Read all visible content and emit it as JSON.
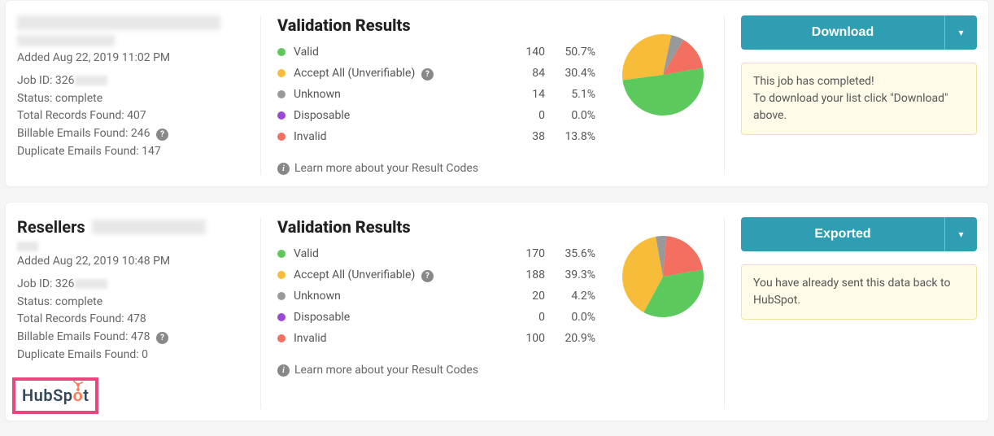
{
  "colors": {
    "valid": "#5cc95c",
    "accept": "#f7bd3a",
    "unknown": "#98999a",
    "disposable": "#9a4bd6",
    "invalid": "#f36f60",
    "btn": "#2f9eb3"
  },
  "common": {
    "vr_title": "Validation Results",
    "labels": {
      "valid": "Valid",
      "accept": "Accept All (Unverifiable)",
      "unknown": "Unknown",
      "disposable": "Disposable",
      "invalid": "Invalid"
    },
    "learn_more": "Learn more about your Result Codes",
    "added_prefix": "Added ",
    "jobid_prefix": "Job ID: 326",
    "status_prefix": "Status: ",
    "total_prefix": "Total Records Found: ",
    "billable_prefix": "Billable Emails Found: ",
    "dup_prefix": "Duplicate Emails Found: "
  },
  "jobs": [
    {
      "title": "",
      "added": "Aug 22, 2019 11:02 PM",
      "status": "complete",
      "total": "407",
      "billable": "246",
      "duplicate": "147",
      "billable_help": true,
      "button": "Download",
      "notice_line1": "This job has completed!",
      "notice_line2": "To download your list click \"Download\" above.",
      "hubspot": false,
      "stats": {
        "valid": {
          "count": "140",
          "pct": "50.7%"
        },
        "accept": {
          "count": "84",
          "pct": "30.4%"
        },
        "unknown": {
          "count": "14",
          "pct": "5.1%"
        },
        "disposable": {
          "count": "0",
          "pct": "0.0%"
        },
        "invalid": {
          "count": "38",
          "pct": "13.8%"
        }
      }
    },
    {
      "title": "Resellers",
      "added": "Aug 22, 2019 10:48 PM",
      "status": "complete",
      "total": "478",
      "billable": "478",
      "duplicate": "0",
      "billable_help": true,
      "button": "Exported",
      "notice_line1": "You have already sent this data back to HubSpot.",
      "notice_line2": "",
      "hubspot": true,
      "stats": {
        "valid": {
          "count": "170",
          "pct": "35.6%"
        },
        "accept": {
          "count": "188",
          "pct": "39.3%"
        },
        "unknown": {
          "count": "20",
          "pct": "4.2%"
        },
        "disposable": {
          "count": "0",
          "pct": "0.0%"
        },
        "invalid": {
          "count": "100",
          "pct": "20.9%"
        }
      }
    }
  ],
  "hubspot_brand": "HubSpot",
  "chart_data": [
    {
      "type": "pie",
      "title": "Validation Results",
      "categories": [
        "Valid",
        "Accept All (Unverifiable)",
        "Unknown",
        "Disposable",
        "Invalid"
      ],
      "values": [
        50.7,
        30.4,
        5.1,
        0.0,
        13.8
      ],
      "colors": [
        "#5cc95c",
        "#f7bd3a",
        "#98999a",
        "#9a4bd6",
        "#f36f60"
      ]
    },
    {
      "type": "pie",
      "title": "Validation Results",
      "categories": [
        "Valid",
        "Accept All (Unverifiable)",
        "Unknown",
        "Disposable",
        "Invalid"
      ],
      "values": [
        35.6,
        39.3,
        4.2,
        0.0,
        20.9
      ],
      "colors": [
        "#5cc95c",
        "#f7bd3a",
        "#98999a",
        "#9a4bd6",
        "#f36f60"
      ]
    }
  ]
}
